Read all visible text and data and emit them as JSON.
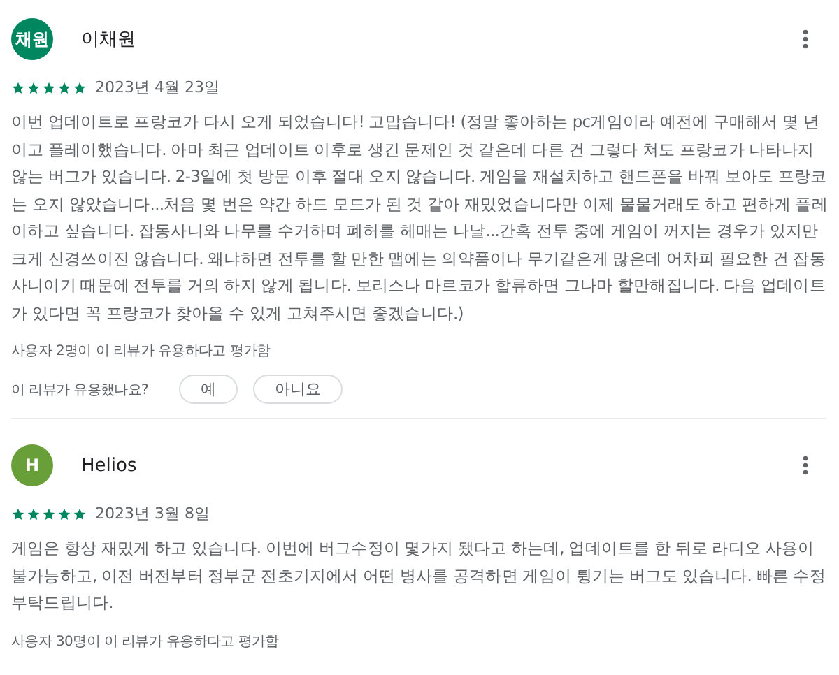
{
  "reviews": [
    {
      "avatar": {
        "text": "채원",
        "color": "#01875f"
      },
      "author": "이채원",
      "stars": 5,
      "date": "2023년 4월 23일",
      "body": "이번 업데이트로 프랑코가 다시 오게 되었습니다! 고맙습니다! (정말 좋아하는 pc게임이라 예전에 구매해서 몇 년이고 플레이했습니다. 아마 최근 업데이트 이후로 생긴 문제인 것 같은데 다른 건 그렇다 쳐도 프랑코가 나타나지 않는 버그가 있습니다. 2-3일에 첫 방문 이후 절대 오지 않습니다. 게임을 재설치하고 핸드폰을 바꿔 보아도 프랑코는 오지 않았습니다...처음 몇 번은 약간 하드 모드가 된 것 같아 재밌었습니다만 이제 물물거래도 하고 편하게 플레이하고 싶습니다. 잡동사니와 나무를 수거하며 폐허를 헤매는 나날...간혹 전투 중에 게임이 꺼지는 경우가 있지만 크게 신경쓰이진 않습니다. 왜냐하면 전투를 할 만한 맵에는 의약품이나 무기같은게 많은데 어차피 필요한 건 잡동사니이기 때문에 전투를 거의 하지 않게 됩니다. 보리스나 마르코가 합류하면 그나마 할만해집니다. 다음 업데이트가 있다면 꼭 프랑코가 찾아올 수 있게 고쳐주시면 좋겠습니다.)",
      "helpful": "사용자 2명이 이 리뷰가 유용하다고 평가함",
      "question": {
        "prompt": "이 리뷰가 유용했나요?",
        "buttons": [
          "예",
          "아니요"
        ]
      }
    },
    {
      "avatar": {
        "text": "H",
        "color": "#689f38"
      },
      "author": "Helios",
      "stars": 5,
      "date": "2023년 3월 8일",
      "body": "게임은 항상 재밌게 하고 있습니다. 이번에 버그수정이 몇가지 됐다고 하는데, 업데이트를 한 뒤로 라디오 사용이 불가능하고, 이전 버전부터 정부군 전초기지에서 어떤 병사를 공격하면 게임이 튕기는 버그도 있습니다. 빠른 수정 부탁드립니다.",
      "helpful": "사용자 30명이 이 리뷰가 유용하다고 평가함"
    }
  ]
}
